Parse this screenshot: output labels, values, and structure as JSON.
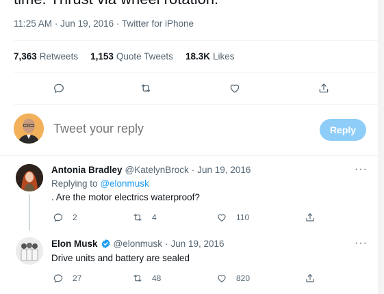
{
  "tweet": {
    "text_cut": "time. Thrust via wheel rotation.",
    "time": "11:25 AM",
    "date": "Jun 19, 2016",
    "source": "Twitter for iPhone"
  },
  "stats": [
    {
      "num": "7,363",
      "label": "Retweets"
    },
    {
      "num": "1,153",
      "label": "Quote Tweets"
    },
    {
      "num": "18.3K",
      "label": "Likes"
    }
  ],
  "compose": {
    "placeholder": "Tweet your reply",
    "button": "Reply"
  },
  "replies": [
    {
      "name": "Antonia Bradley",
      "handle": "@KatelynBrock",
      "date": "Jun 19, 2016",
      "replying_prefix": "Replying to",
      "replying_to": "@elonmusk",
      "text": ". Are the motor electrics waterproof?",
      "replies": "2",
      "retweets": "4",
      "likes": "110"
    },
    {
      "name": "Elon Musk",
      "handle": "@elonmusk",
      "date": "Jun 19, 2016",
      "text": "Drive units and battery are sealed",
      "replies": "27",
      "retweets": "48",
      "likes": "820"
    }
  ],
  "separators": {
    "dot": "·",
    "more": "···"
  },
  "colors": {
    "accent": "#1d9bf0",
    "reply_button": "#8ecdf8",
    "muted": "#536471",
    "border": "#eff3f4"
  },
  "icons": [
    "reply-icon",
    "retweet-icon",
    "like-icon",
    "share-icon",
    "verified-badge-icon",
    "more-icon"
  ]
}
